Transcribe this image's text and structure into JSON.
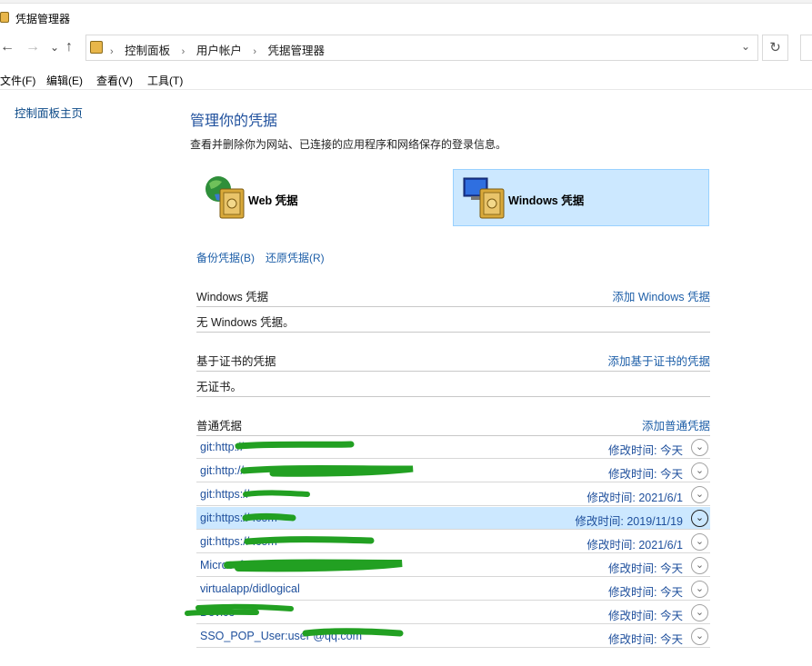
{
  "window": {
    "title": "凭据管理器"
  },
  "address": {
    "crumbs": [
      "控制面板",
      "用户帐户",
      "凭据管理器"
    ]
  },
  "menu": [
    "文件(F)",
    "编辑(E)",
    "查看(V)",
    "工具(T)"
  ],
  "sidebar": {
    "home_link": "控制面板主页"
  },
  "main": {
    "title": "管理你的凭据",
    "description": "查看并删除你为网站、已连接的应用程序和网络保存的登录信息。",
    "tiles": {
      "web": "Web 凭据",
      "windows": "Windows 凭据"
    },
    "backup": "备份凭据(B)",
    "restore": "还原凭据(R)"
  },
  "sections": {
    "windows": {
      "title": "Windows 凭据",
      "add": "添加 Windows 凭据",
      "empty": "无 Windows 凭据。"
    },
    "cert": {
      "title": "基于证书的凭据",
      "add": "添加基于证书的凭据",
      "empty": "无证书。"
    },
    "generic": {
      "title": "普通凭据",
      "add": "添加普通凭据",
      "rows": [
        {
          "name": "git:http://",
          "modified": "修改时间:  今天"
        },
        {
          "name": "git:http://",
          "modified": "修改时间:  今天"
        },
        {
          "name": "git:https://",
          "modified": "修改时间:  2021/6/1"
        },
        {
          "name": "git:https://                .com",
          "modified": "修改时间:  2019/11/19"
        },
        {
          "name": "git:https://                                    .com",
          "modified": "修改时间:  2021/6/1"
        },
        {
          "name": "Microsoft                                    @qq.com",
          "modified": "修改时间:  今天"
        },
        {
          "name": "virtualapp/didlogical",
          "modified": "修改时间:  今天"
        },
        {
          "name": "              Device",
          "modified": "修改时间:  今天"
        },
        {
          "name": "SSO_POP_User:user                       @qq.com",
          "modified": "修改时间:  今天"
        }
      ]
    }
  },
  "icons": {
    "back": "←",
    "forward": "→",
    "recent": "⌄",
    "up": "↑",
    "chevron": "›",
    "dropdown": "⌄",
    "refresh": "↻",
    "expand": "⌄"
  },
  "colors": {
    "link": "#1e5fa8",
    "selected": "#cce8ff",
    "redaction": "#22a022"
  }
}
